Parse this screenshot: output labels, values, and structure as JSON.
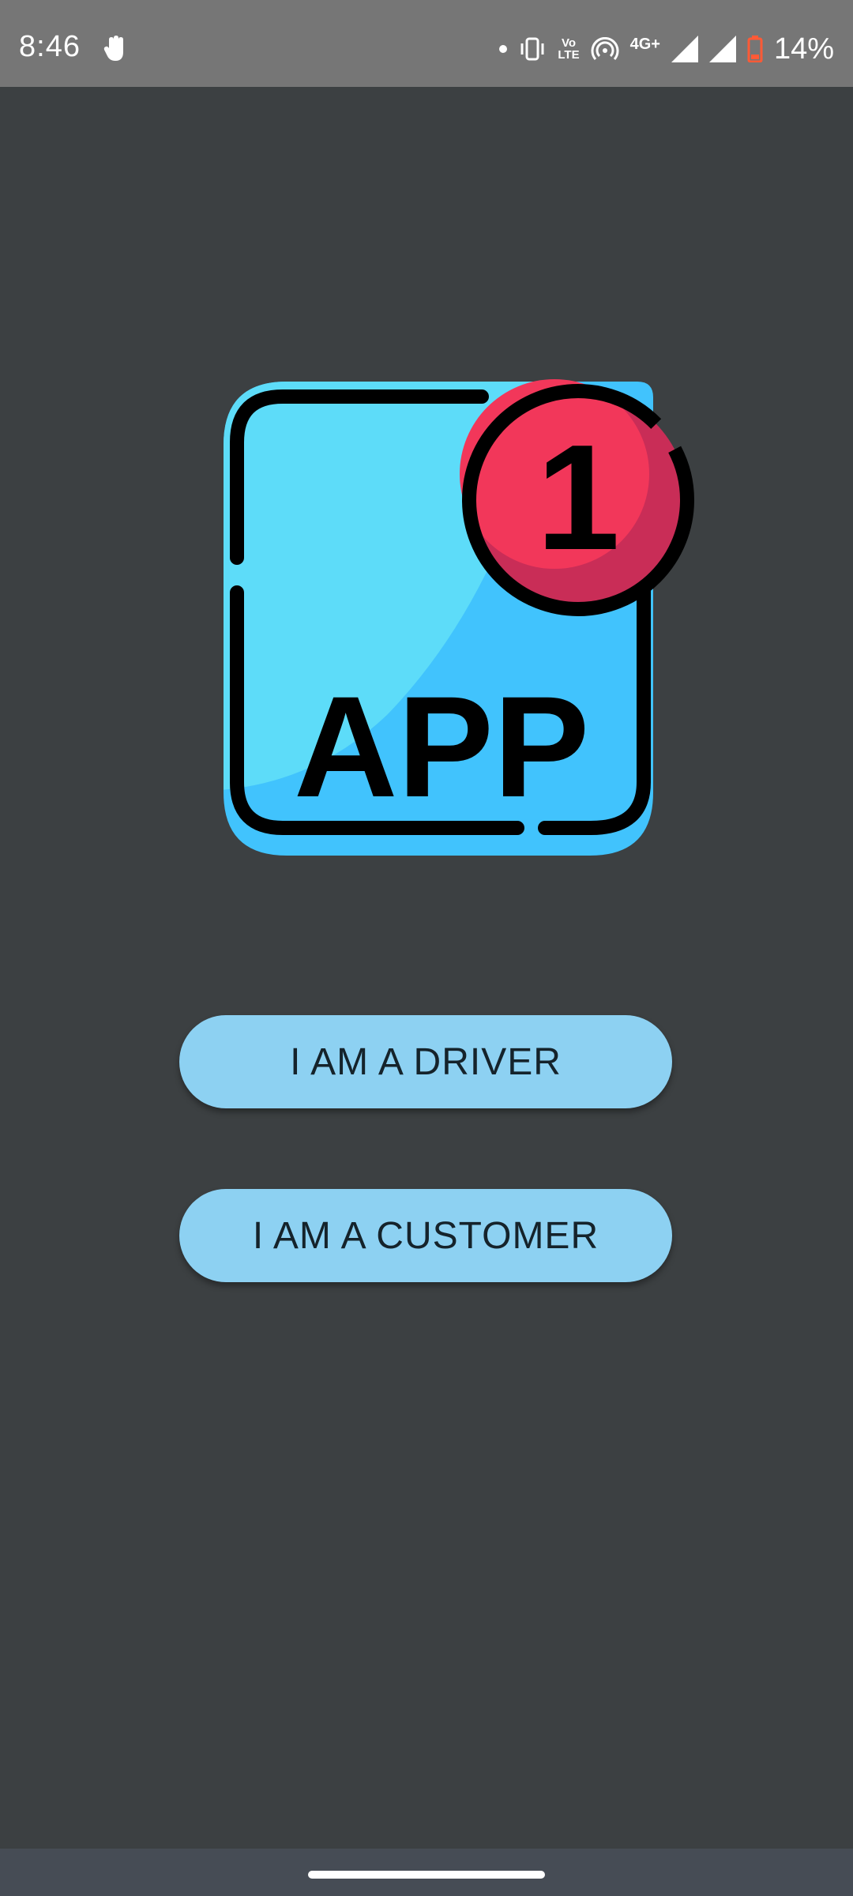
{
  "status_bar": {
    "time": "8:46",
    "volte_line1": "Vo",
    "volte_line2": "LTE",
    "network": "4G+",
    "battery_percent": "14%",
    "icons": [
      "gesture-hand-icon",
      "dot-icon",
      "vibrate-icon",
      "volte-icon",
      "hotspot-icon",
      "signal-icon",
      "signal-icon",
      "battery-icon"
    ]
  },
  "logo": {
    "text": "APP",
    "badge_count": "1",
    "colors": {
      "tile_light": "#5ddcf9",
      "tile_dark": "#41c3fd",
      "badge_red": "#f2375a",
      "badge_shade": "#c92d57",
      "outline": "#000000"
    }
  },
  "buttons": {
    "driver_label": "I AM A DRIVER",
    "customer_label": "I AM A CUSTOMER",
    "color": "#8dd1f2"
  },
  "colors": {
    "background": "#3c4042",
    "status_bar": "#767676",
    "nav_bar": "#464c55"
  }
}
